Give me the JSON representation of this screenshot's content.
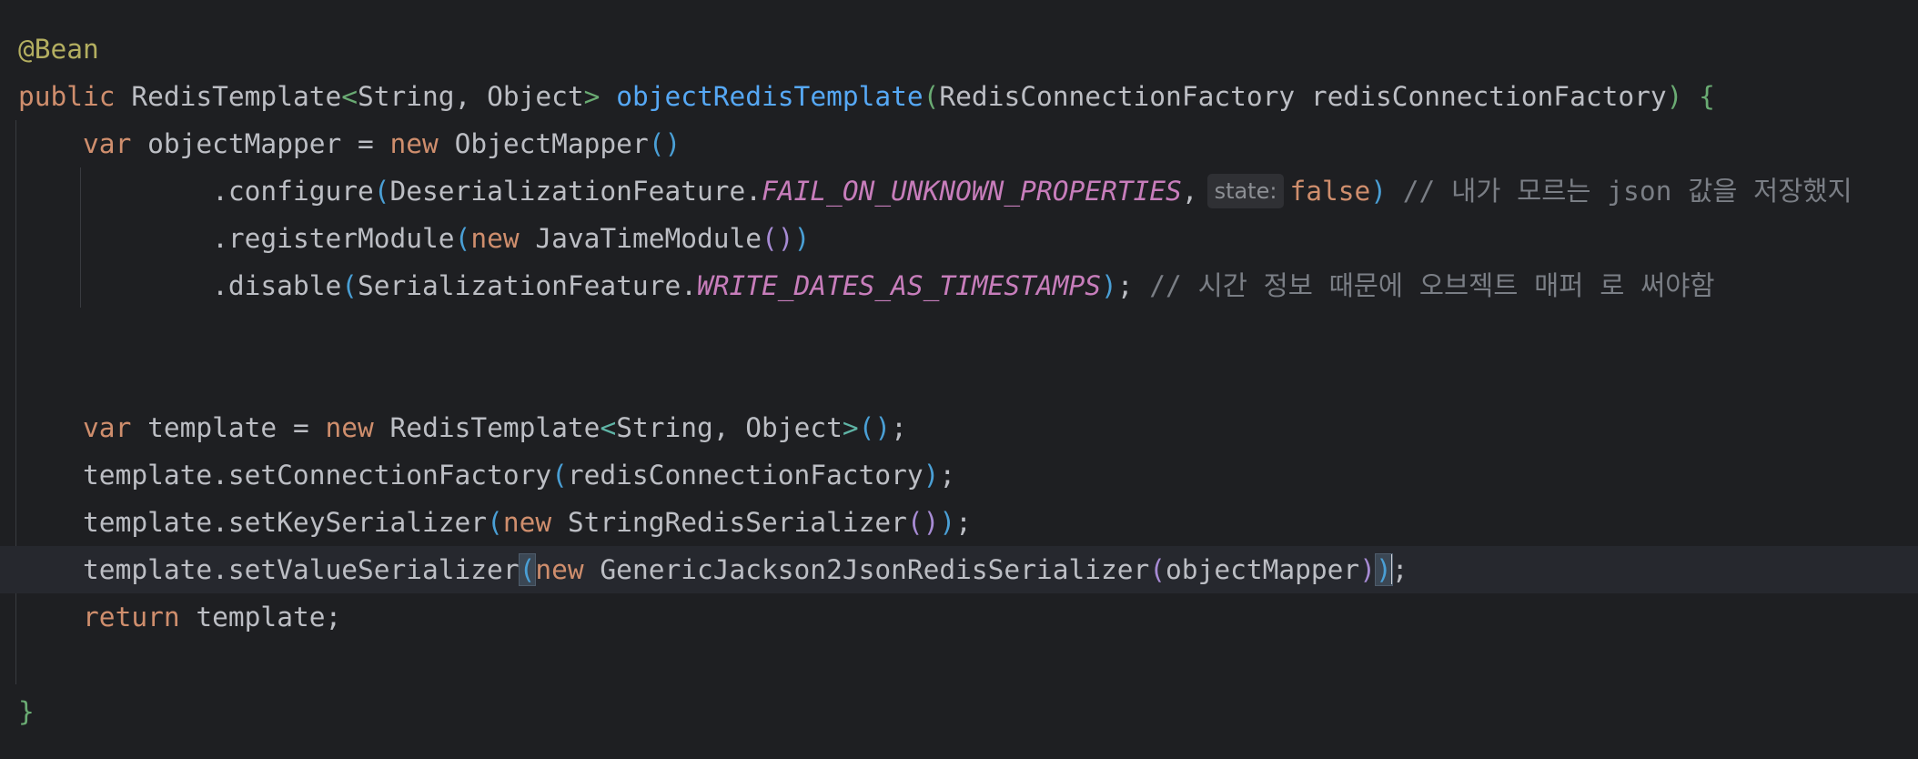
{
  "editor": {
    "lines": {
      "l1": {
        "annotation": "@Bean"
      },
      "l2": {
        "kw_public": "public",
        "type": "RedisTemplate",
        "lt": "<",
        "generics": "String, Object",
        "gt": ">",
        "method": "objectRedisTemplate",
        "open": "(",
        "params": "RedisConnectionFactory redisConnectionFactory",
        "close": ")",
        "brace": "{"
      },
      "l3": {
        "kw_var": "var",
        "decl": " objectMapper = ",
        "kw_new": "new",
        "ctor": " ObjectMapper",
        "parens": "()"
      },
      "l4": {
        "call": ".configure",
        "open": "(",
        "cls": "DeserializationFeature.",
        "konst": "FAIL_ON_UNKNOWN_PROPERTIES",
        "comma": ",",
        "hint": "state:",
        "kw_false": "false",
        "close": ")",
        "comment": " // 내가 모르는 json 값을 저장했지"
      },
      "l5": {
        "call": ".registerModule",
        "open": "(",
        "kw_new": "new",
        "ctor": " JavaTimeModule",
        "inner": "()",
        "close": ")"
      },
      "l6": {
        "call": ".disable",
        "open": "(",
        "cls": "SerializationFeature.",
        "konst": "WRITE_DATES_AS_TIMESTAMPS",
        "close": ")",
        "semi": ";",
        "comment": " // 시간 정보 때문에 오브젝트 매퍼 로 써야함"
      },
      "l9": {
        "kw_var": "var",
        "decl": " template = ",
        "kw_new": "new",
        "ctor": " RedisTemplate",
        "lt": "<",
        "generics": "String, Object",
        "gt": ">",
        "parens": "()",
        "semi": ";"
      },
      "l10": {
        "call": "template.setConnectionFactory",
        "open": "(",
        "arg": "redisConnectionFactory",
        "close": ")",
        "semi": ";"
      },
      "l11": {
        "call": "template.setKeySerializer",
        "open": "(",
        "kw_new": "new",
        "ctor": " StringRedisSerializer",
        "inner": "()",
        "close": ")",
        "semi": ";"
      },
      "l12": {
        "call": "template.setValueSerializer",
        "open": "(",
        "kw_new": "new",
        "ctor": " GenericJackson2JsonRedisSerializer",
        "inner_open": "(",
        "arg": "objectMapper",
        "inner_close": ")",
        "close": ")",
        "semi": ";"
      },
      "l13": {
        "kw_return": "return",
        "rest": " template;"
      },
      "l15": {
        "brace": "}"
      }
    }
  },
  "colors": {
    "background": "#1e1f22",
    "current_line": "#26282e",
    "keyword": "#cf8e6d",
    "method_decl": "#56a8f5",
    "constant": "#c77dbb",
    "comment": "#7a7e85",
    "annotation": "#b3ae60",
    "brace": "#6aab73"
  }
}
